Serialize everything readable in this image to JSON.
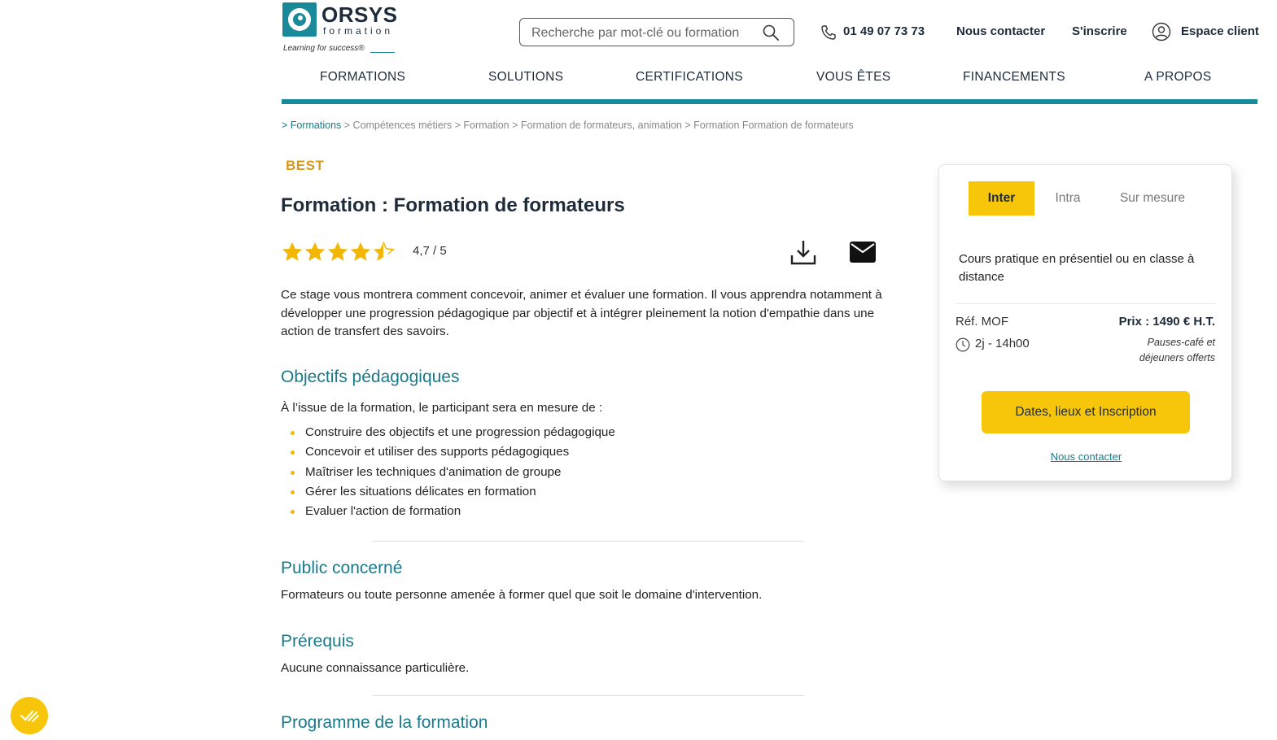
{
  "brand": {
    "name": "ORSYS",
    "sub": "formation",
    "tagline": "Learning for success®"
  },
  "search": {
    "placeholder": "Recherche par mot-clé ou formation"
  },
  "header_links": {
    "phone": "01 49 07 73 73",
    "contact": "Nous contacter",
    "signup": "S'inscrire",
    "client": "Espace client"
  },
  "nav": [
    "FORMATIONS",
    "SOLUTIONS",
    "CERTIFICATIONS",
    "VOUS ÊTES",
    "FINANCEMENTS",
    "A PROPOS"
  ],
  "breadcrumb": {
    "first": "> Formations",
    "rest": " > Compétences métiers > Formation > Formation de formateurs, animation > Formation Formation de formateurs"
  },
  "course": {
    "badge": "BEST",
    "title": "Formation : Formation de formateurs",
    "rating_text": "4,7 / 5",
    "rating_value": 4.7,
    "description": "Ce stage vous montrera comment concevoir, animer et évaluer une formation. Il vous apprendra notamment à développer une progression pédagogique par objectif et à intégrer pleinement la notion d'empathie dans une action de transfert des savoirs."
  },
  "objectives": {
    "heading": "Objectifs pédagogiques",
    "intro": "À l’issue de la formation, le participant sera en mesure de :",
    "items": [
      "Construire des objectifs et une progression pédagogique",
      "Concevoir et utiliser des supports pédagogiques",
      "Maîtriser les techniques d'animation de groupe",
      "Gérer les situations délicates en formation",
      "Evaluer l'action de formation"
    ]
  },
  "public": {
    "heading": "Public concerné",
    "text": "Formateurs ou toute personne amenée à former quel que soit le domaine d'intervention."
  },
  "prereq": {
    "heading": "Prérequis",
    "text": "Aucune connaissance particulière."
  },
  "program": {
    "heading": "Programme de la formation"
  },
  "card": {
    "tabs": [
      "Inter",
      "Intra",
      "Sur mesure"
    ],
    "active_tab": "Inter",
    "text": "Cours pratique en présentiel ou en classe à distance",
    "ref": "Réf. MOF",
    "price": "Prix : 1490 € H.T.",
    "duration": "2j - 14h00",
    "pauses": "Pauses-café et déjeuners offerts",
    "cta": "Dates, lieux et Inscription",
    "contact": "Nous contacter"
  },
  "colors": {
    "teal": "#1a8a9a",
    "yellow": "#f7c60a",
    "gold": "#d99a1a"
  }
}
